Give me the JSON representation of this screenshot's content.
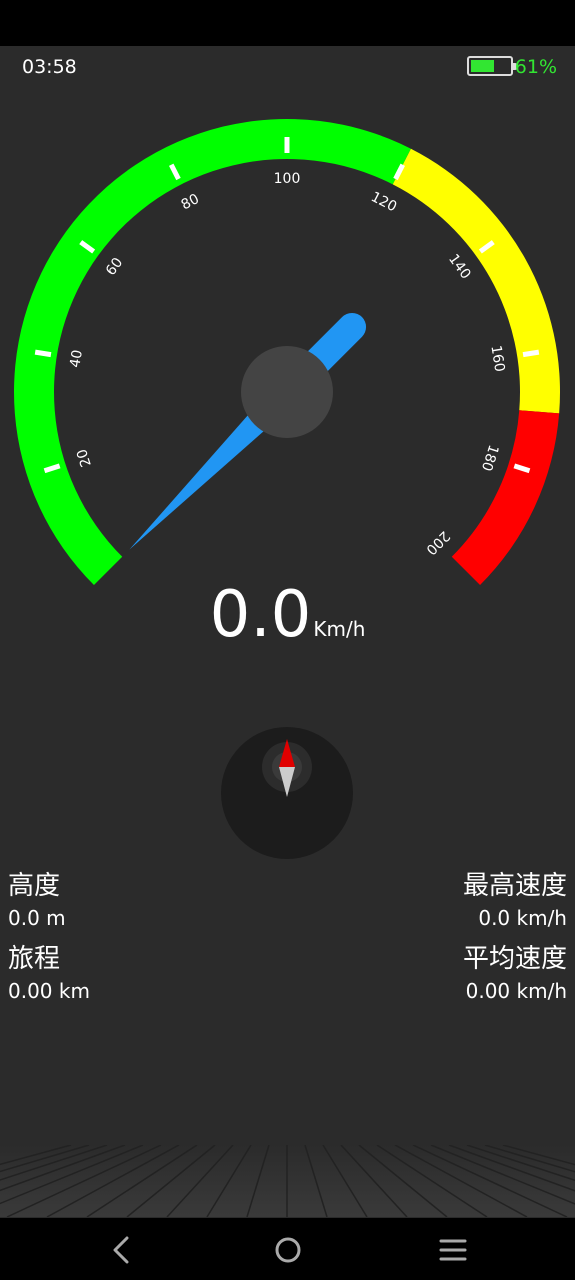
{
  "status_bar": {
    "time": "03:58",
    "battery_percent_label": "61%",
    "battery_level": 0.61,
    "battery_color": "#32e632"
  },
  "speedometer": {
    "min": 0,
    "max": 200,
    "tick_labels": [
      "20",
      "40",
      "60",
      "80",
      "100",
      "120",
      "140",
      "160",
      "180",
      "200"
    ],
    "current_speed": 0.0,
    "speed_text": "0.0",
    "unit": "Km/h",
    "zones": [
      {
        "from": 0,
        "to": 120,
        "color": "#00ff00"
      },
      {
        "from": 120,
        "to": 170,
        "color": "#ffff00"
      },
      {
        "from": 170,
        "to": 200,
        "color": "#ff0000"
      }
    ],
    "needle_color": "#2196f3",
    "hub_color": "#444444"
  },
  "compass": {
    "north_color": "#e00000",
    "south_color": "#cccccc"
  },
  "stats": {
    "altitude": {
      "label": "高度",
      "value": "0.0 m"
    },
    "trip": {
      "label": "旅程",
      "value": "0.00 km"
    },
    "max_speed": {
      "label": "最高速度",
      "value": "0.0 km/h"
    },
    "avg_speed": {
      "label": "平均速度",
      "value": "0.00 km/h"
    }
  },
  "nav_bar": {
    "icons": [
      "back-icon",
      "home-icon",
      "menu-icon"
    ]
  }
}
